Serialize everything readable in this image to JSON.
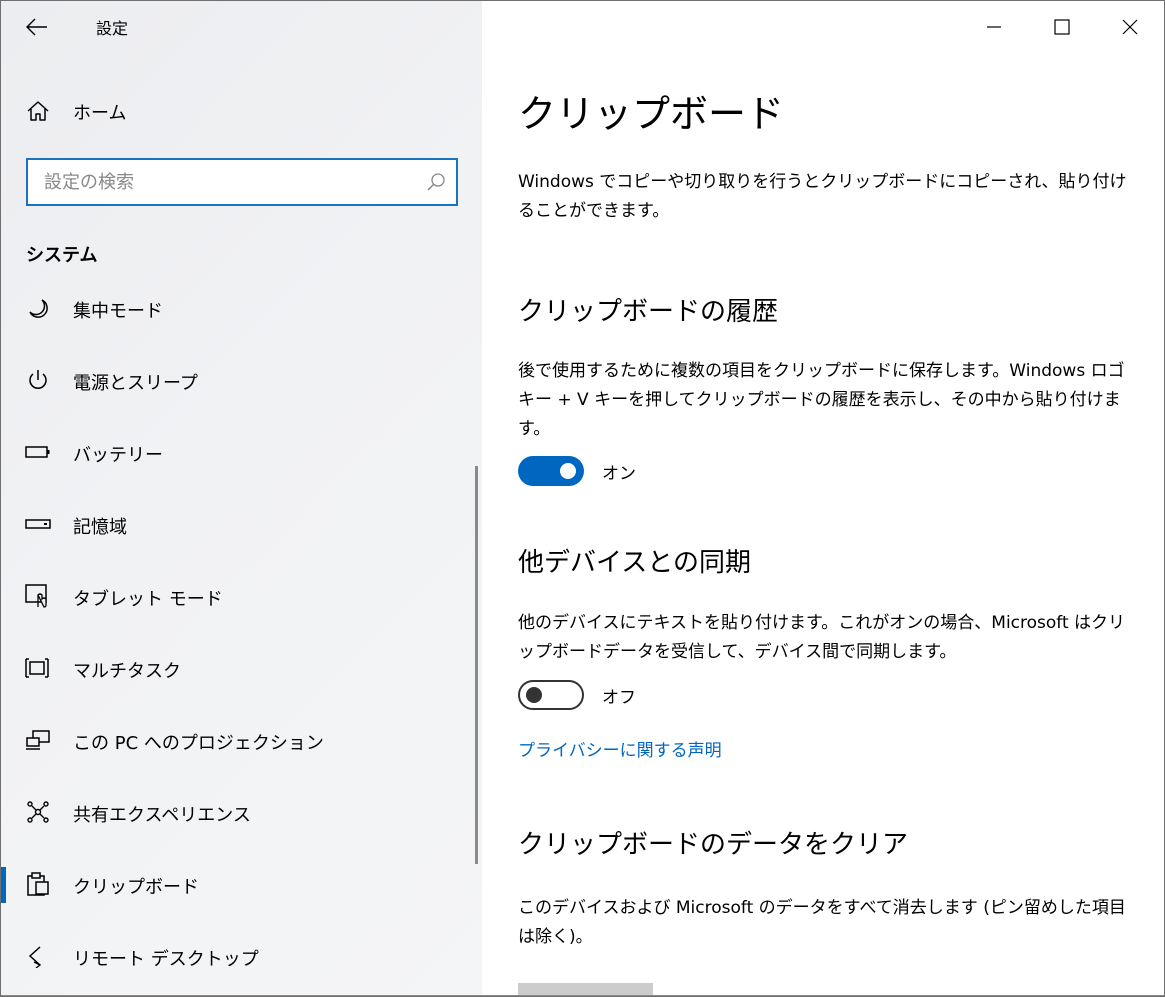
{
  "window": {
    "title": "設定"
  },
  "sidebar": {
    "home_label": "ホーム",
    "search_placeholder": "設定の検索",
    "section_heading": "システム",
    "items": [
      {
        "label": "集中モード",
        "icon": "moon-icon"
      },
      {
        "label": "電源とスリープ",
        "icon": "power-icon"
      },
      {
        "label": "バッテリー",
        "icon": "battery-icon"
      },
      {
        "label": "記憶域",
        "icon": "storage-icon"
      },
      {
        "label": "タブレット モード",
        "icon": "tablet-mode-icon"
      },
      {
        "label": "マルチタスク",
        "icon": "multitasking-icon"
      },
      {
        "label": "この PC へのプロジェクション",
        "icon": "projection-icon"
      },
      {
        "label": "共有エクスペリエンス",
        "icon": "shared-experiences-icon"
      },
      {
        "label": "クリップボード",
        "icon": "clipboard-icon",
        "selected": true
      },
      {
        "label": "リモート デスクトップ",
        "icon": "remote-desktop-icon"
      }
    ]
  },
  "main": {
    "title": "クリップボード",
    "intro": "Windows でコピーや切り取りを行うとクリップボードにコピーされ、貼り付けることができます。",
    "history": {
      "heading": "クリップボードの履歴",
      "description": "後で使用するために複数の項目をクリップボードに保存します。Windows ロゴ キー + V キーを押してクリップボードの履歴を表示し、その中から貼り付けます。",
      "toggle_state": "オン",
      "toggle_on": true
    },
    "sync": {
      "heading": "他デバイスとの同期",
      "description": "他のデバイスにテキストを貼り付けます。これがオンの場合、Microsoft はクリップボードデータを受信して、デバイス間で同期します。",
      "toggle_state": "オフ",
      "toggle_on": false
    },
    "privacy_link": "プライバシーに関する声明",
    "clear": {
      "heading": "クリップボードのデータをクリア",
      "description": "このデバイスおよび Microsoft のデータをすべて消去します (ピン留めした項目は除く)。"
    }
  },
  "colors": {
    "accent": "#0067c0",
    "sidebar_bg": "#f0f1f3",
    "toggle_off_border": "#333333"
  }
}
